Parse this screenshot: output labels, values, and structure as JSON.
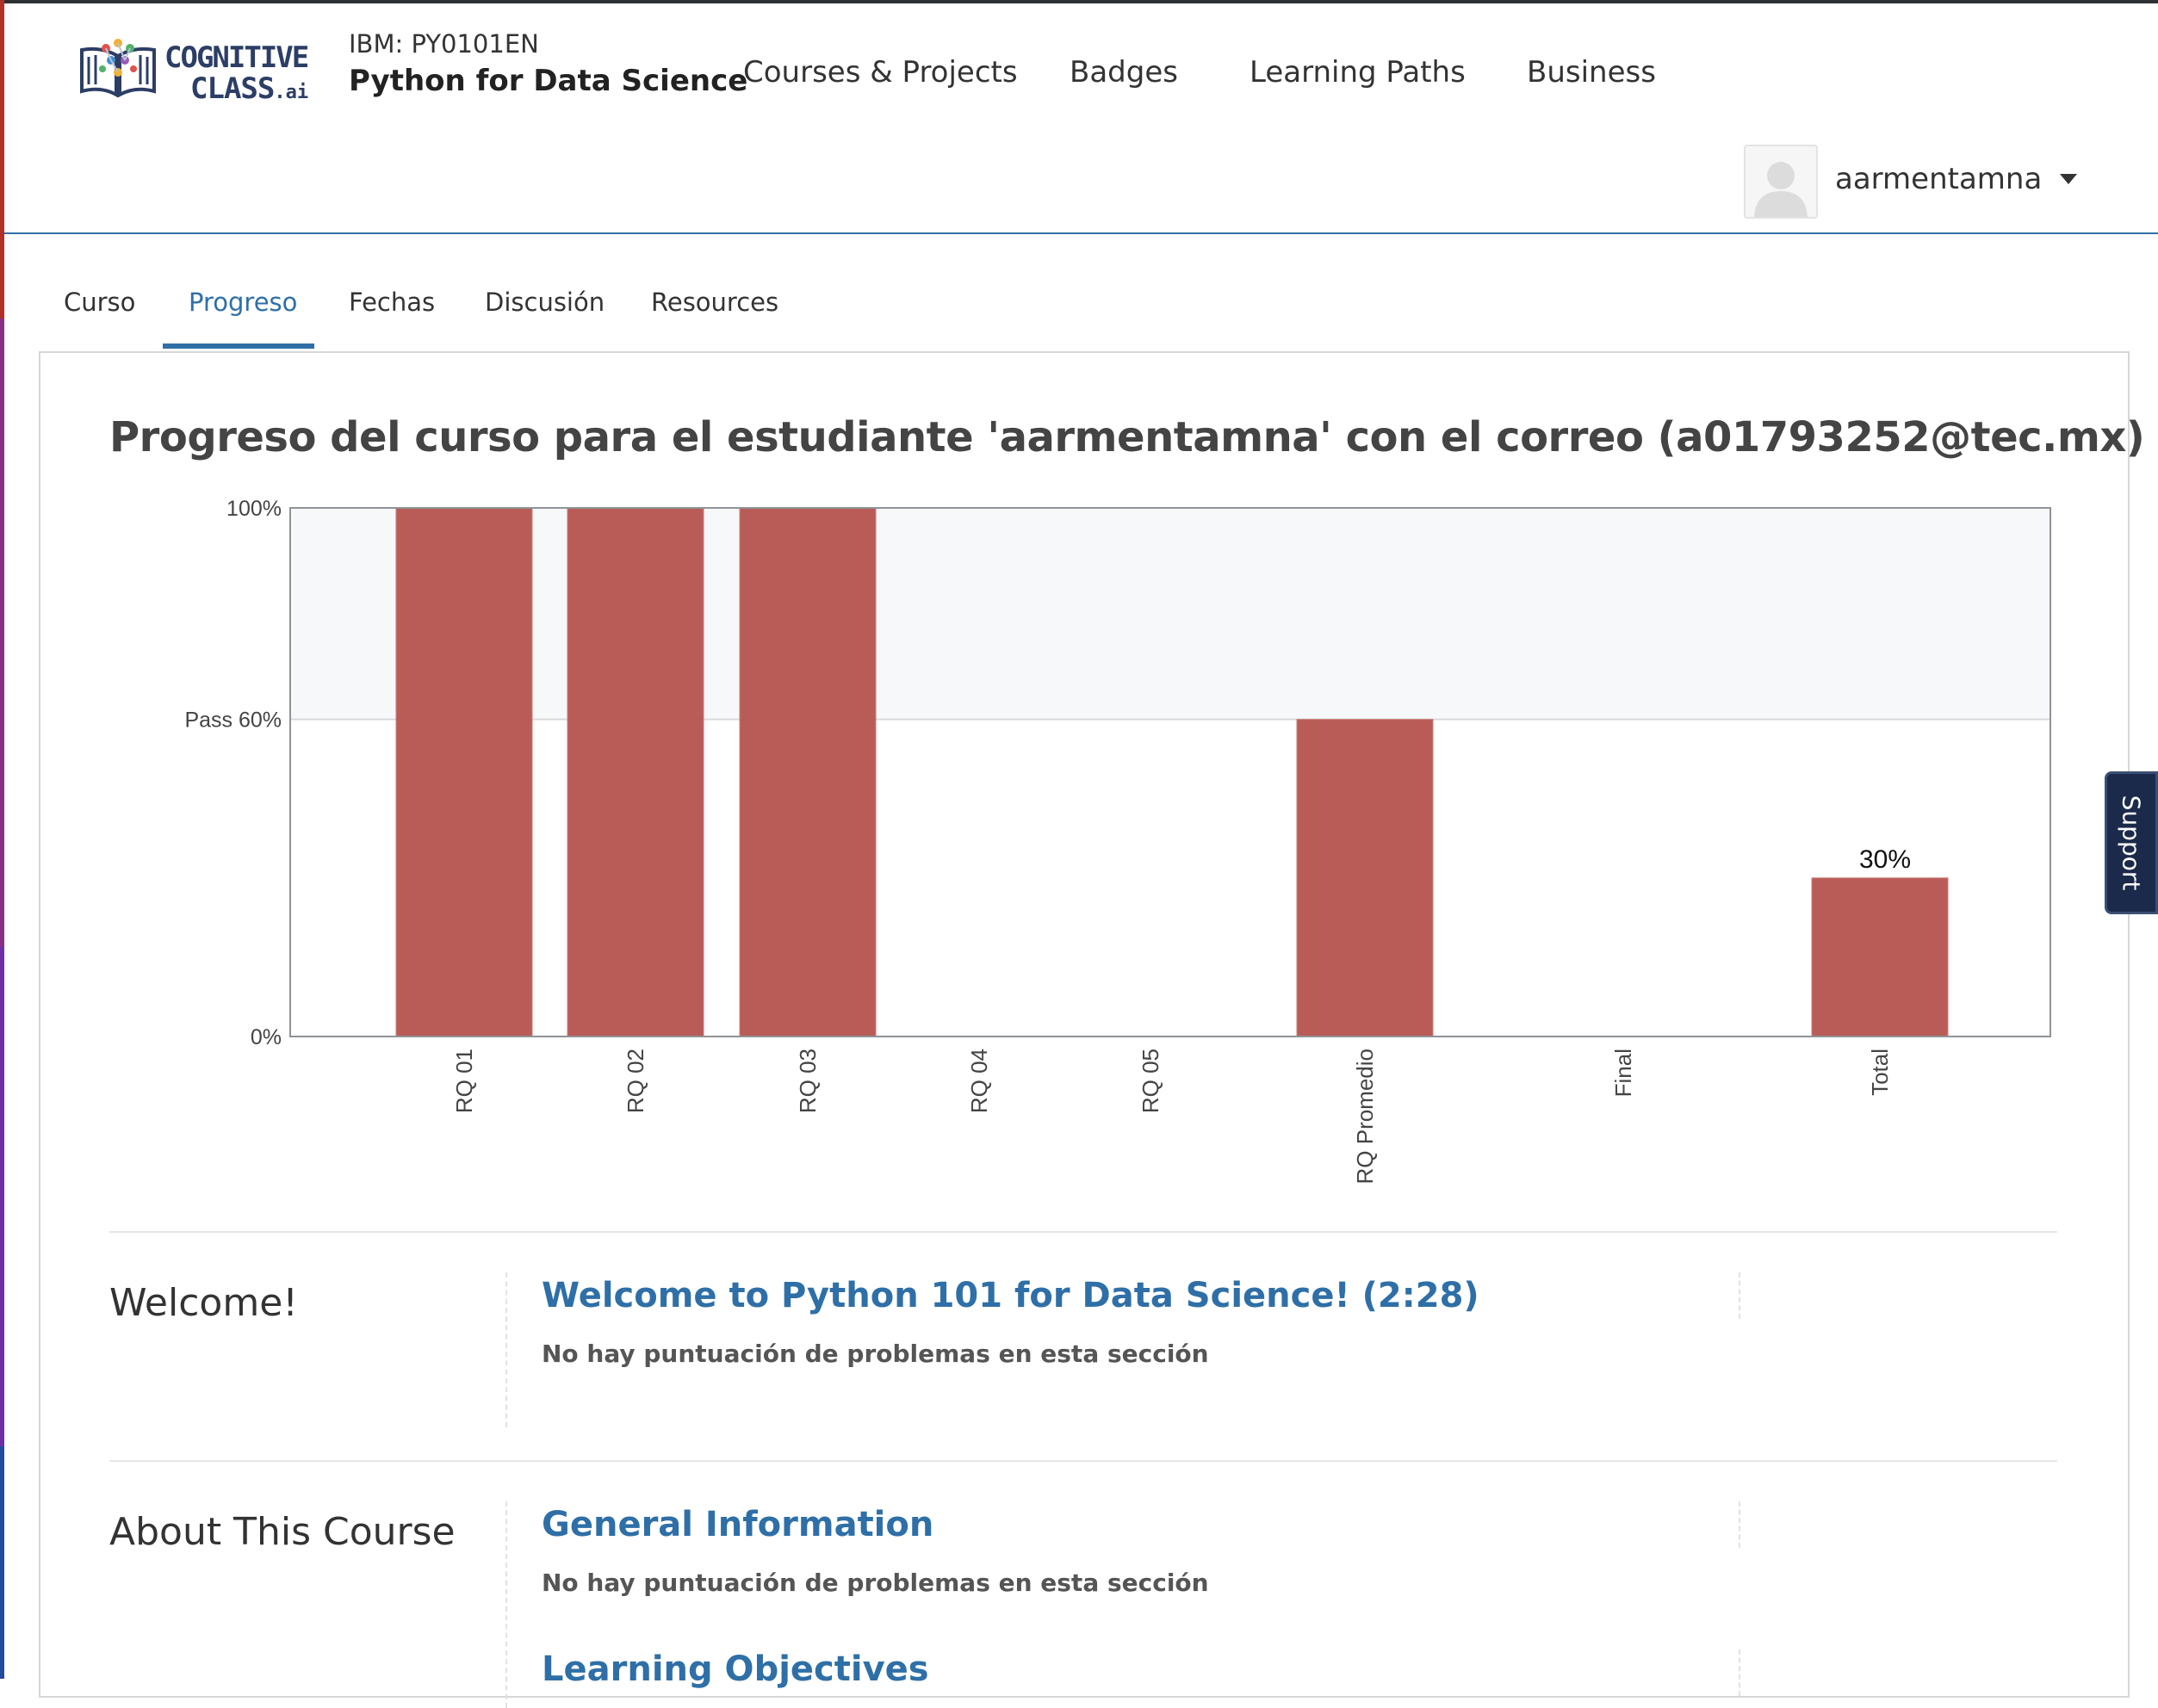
{
  "header": {
    "logo_label": "Cognitive Class",
    "logo_line1": "COGNITIVE",
    "logo_line2": "CLASS",
    "logo_suffix": ".ai",
    "course_code": "IBM: PY0101EN",
    "course_name": "Python for Data Science",
    "nav": [
      {
        "label": "Courses & Projects"
      },
      {
        "label": "Badges"
      },
      {
        "label": "Learning Paths"
      },
      {
        "label": "Business"
      }
    ],
    "user": {
      "name": "aarmentamna",
      "avatar_icon": "avatar-placeholder-icon",
      "menu_icon": "caret-down-icon"
    }
  },
  "tabs": [
    {
      "label": "Curso",
      "active": false
    },
    {
      "label": "Progreso",
      "active": true
    },
    {
      "label": "Fechas",
      "active": false
    },
    {
      "label": "Discusión",
      "active": false
    },
    {
      "label": "Resources",
      "active": false
    }
  ],
  "page": {
    "title": "Progreso del curso para el estudiante 'aarmentamna' con el correo (a01793252@tec.mx)"
  },
  "chart_data": {
    "type": "bar",
    "categories": [
      "RQ 01",
      "RQ 02",
      "RQ 03",
      "RQ 04",
      "RQ 05",
      "RQ Promedio",
      "Final",
      "Total"
    ],
    "values": [
      100,
      100,
      100,
      0,
      0,
      60,
      0,
      30
    ],
    "ylim": [
      0,
      100
    ],
    "y_ticks": [
      {
        "value": 0,
        "label": "0%"
      },
      {
        "value": 60,
        "label": "Pass 60%"
      },
      {
        "value": 100,
        "label": "100%"
      }
    ],
    "pass_threshold": 60,
    "data_labels": [
      {
        "category": "Total",
        "label": "30%"
      }
    ],
    "bar_color": "#b5524c",
    "pass_band_color": "#f7f8f9",
    "grid": false,
    "legend": "none"
  },
  "sections": [
    {
      "title": "Welcome!",
      "subsections": [
        {
          "title": "Welcome to Python 101 for Data Science! (2:28)",
          "note": "No hay puntuación de problemas en esta sección"
        }
      ]
    },
    {
      "title": "About This Course",
      "subsections": [
        {
          "title": "General Information",
          "note": "No hay puntuación de problemas en esta sección"
        },
        {
          "title": "Learning Objectives",
          "note": ""
        }
      ]
    }
  ],
  "support": {
    "label": "Support"
  },
  "colors": {
    "accent": "#2f6fa7",
    "bar": "#b5524c",
    "support_bg": "#1b2a4a"
  }
}
